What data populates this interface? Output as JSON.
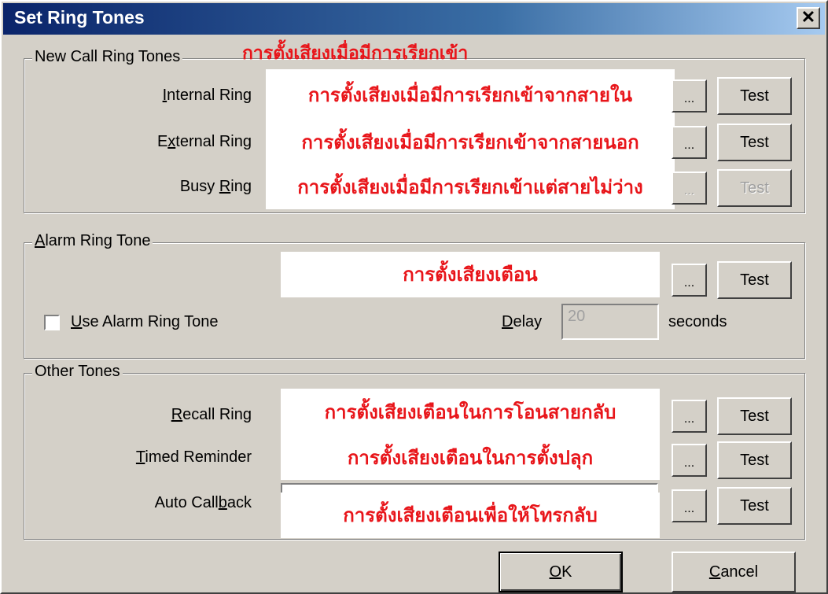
{
  "window": {
    "title": "Set Ring Tones",
    "close_label": "✕"
  },
  "new_call": {
    "legend": "New Call Ring Tones",
    "annotation": "การตั้งเสียงเมื่อมีการเรียกเข้า",
    "rows": [
      {
        "label_pre": "",
        "label_key": "I",
        "label_post": "nternal Ring",
        "overlay": "การตั้งเสียงเมื่อมีการเรียกเข้าจากสายใน",
        "browse": "...",
        "test": "Test"
      },
      {
        "label_pre": "E",
        "label_key": "x",
        "label_post": "ternal Ring",
        "overlay": "การตั้งเสียงเมื่อมีการเรียกเข้าจากสายนอก",
        "browse": "...",
        "test": "Test"
      },
      {
        "label_pre": "Busy ",
        "label_key": "R",
        "label_post": "ing",
        "overlay": "การตั้งเสียงเมื่อมีการเรียกเข้าแต่สายไม่ว่าง",
        "browse": "...",
        "test": "Test"
      }
    ]
  },
  "alarm": {
    "legend_key": "A",
    "legend_rest": "larm Ring Tone",
    "overlay": "การตั้งเสียงเตือน",
    "browse": "...",
    "test": "Test",
    "checkbox_key": "U",
    "checkbox_rest": "se Alarm Ring Tone",
    "delay_key": "D",
    "delay_rest": "elay",
    "delay_value": "20",
    "seconds_label": "seconds"
  },
  "other": {
    "legend": "Other Tones",
    "rows": [
      {
        "label_pre": "",
        "label_key": "R",
        "label_post": "ecall Ring",
        "overlay": "การตั้งเสียงเตือนในการโอนสายกลับ",
        "browse": "...",
        "test": "Test"
      },
      {
        "label_pre": "",
        "label_key": "T",
        "label_post": "imed Reminder",
        "overlay": "การตั้งเสียงเตือนในการตั้งปลุก",
        "browse": "...",
        "test": "Test"
      },
      {
        "label_pre": "Auto Call",
        "label_key": "b",
        "label_post": "ack",
        "overlay": "การตั้งเสียงเตือนเพื่อให้โทรกลับ",
        "browse": "...",
        "test": "Test"
      }
    ]
  },
  "footer": {
    "ok_key": "O",
    "ok_rest": "K",
    "cancel_key": "C",
    "cancel_rest": "ancel"
  }
}
